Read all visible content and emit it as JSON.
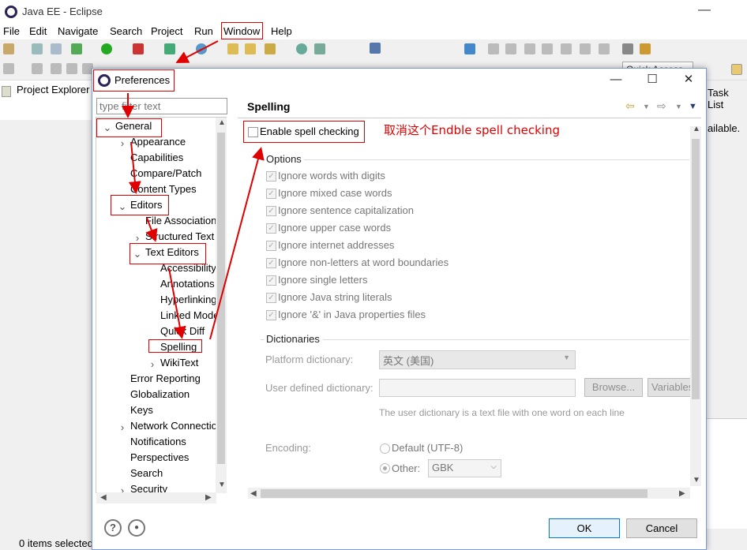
{
  "eclipse": {
    "title": "Java EE - Eclipse",
    "minimize": "—",
    "menus": [
      "File",
      "Edit",
      "Navigate",
      "Search",
      "Project",
      "Run",
      "Window",
      "Help"
    ],
    "quick_access": "Quick Access",
    "project_explorer_tab": "Project Explorer",
    "task_list_tab": "Task List",
    "right_panel_text": "ailable.",
    "status_text": "0 items selected"
  },
  "dialog": {
    "title": "Preferences",
    "controls": {
      "minimize": "—",
      "maximize": "☐",
      "close": "✕"
    },
    "filter_placeholder": "type filter text",
    "tree": [
      {
        "label": "General",
        "twisty": "open"
      },
      {
        "label": "Appearance",
        "twisty": "closed"
      },
      {
        "label": "Capabilities",
        "twisty": ""
      },
      {
        "label": "Compare/Patch",
        "twisty": ""
      },
      {
        "label": "Content Types",
        "twisty": ""
      },
      {
        "label": "Editors",
        "twisty": "open"
      },
      {
        "label": "File Associations",
        "twisty": ""
      },
      {
        "label": "Structured Text",
        "twisty": "closed"
      },
      {
        "label": "Text Editors",
        "twisty": "open"
      },
      {
        "label": "Accessibility",
        "twisty": ""
      },
      {
        "label": "Annotations",
        "twisty": ""
      },
      {
        "label": "Hyperlinking",
        "twisty": ""
      },
      {
        "label": "Linked Mode",
        "twisty": ""
      },
      {
        "label": "Quick Diff",
        "twisty": ""
      },
      {
        "label": "Spelling",
        "twisty": ""
      },
      {
        "label": "WikiText",
        "twisty": "closed"
      },
      {
        "label": "Error Reporting",
        "twisty": ""
      },
      {
        "label": "Globalization",
        "twisty": ""
      },
      {
        "label": "Keys",
        "twisty": ""
      },
      {
        "label": "Network Connections",
        "twisty": "closed"
      },
      {
        "label": "Notifications",
        "twisty": ""
      },
      {
        "label": "Perspectives",
        "twisty": ""
      },
      {
        "label": "Search",
        "twisty": ""
      },
      {
        "label": "Security",
        "twisty": "closed"
      }
    ],
    "page_title": "Spelling",
    "enable_spell_checking": {
      "label": "Enable spell checking",
      "checked": false
    },
    "options_group": "Options",
    "options": [
      {
        "label": "Ignore words with digits",
        "checked": true
      },
      {
        "label": "Ignore mixed case words",
        "checked": true
      },
      {
        "label": "Ignore sentence capitalization",
        "checked": true
      },
      {
        "label": "Ignore upper case words",
        "checked": true
      },
      {
        "label": "Ignore internet addresses",
        "checked": true
      },
      {
        "label": "Ignore non-letters at word boundaries",
        "checked": true
      },
      {
        "label": "Ignore single letters",
        "checked": true
      },
      {
        "label": "Ignore Java string literals",
        "checked": true
      },
      {
        "label": "Ignore '&' in Java properties files",
        "checked": true
      }
    ],
    "dictionaries_group": "Dictionaries",
    "platform_dictionary_label": "Platform dictionary:",
    "platform_dictionary_value": "英文 (美国)",
    "user_dictionary_label": "User defined dictionary:",
    "user_dictionary_value": "",
    "browse_button": "Browse...",
    "variables_button": "Variables...",
    "user_dictionary_hint": "The user dictionary is a text file with one word on each line",
    "encoding_label": "Encoding:",
    "encoding_default": "Default (UTF-8)",
    "encoding_other": "Other:",
    "encoding_other_value": "GBK",
    "ok_button": "OK",
    "cancel_button": "Cancel"
  },
  "annotation": {
    "text": "取消这个Endble spell checking",
    "color": "#e00000"
  }
}
